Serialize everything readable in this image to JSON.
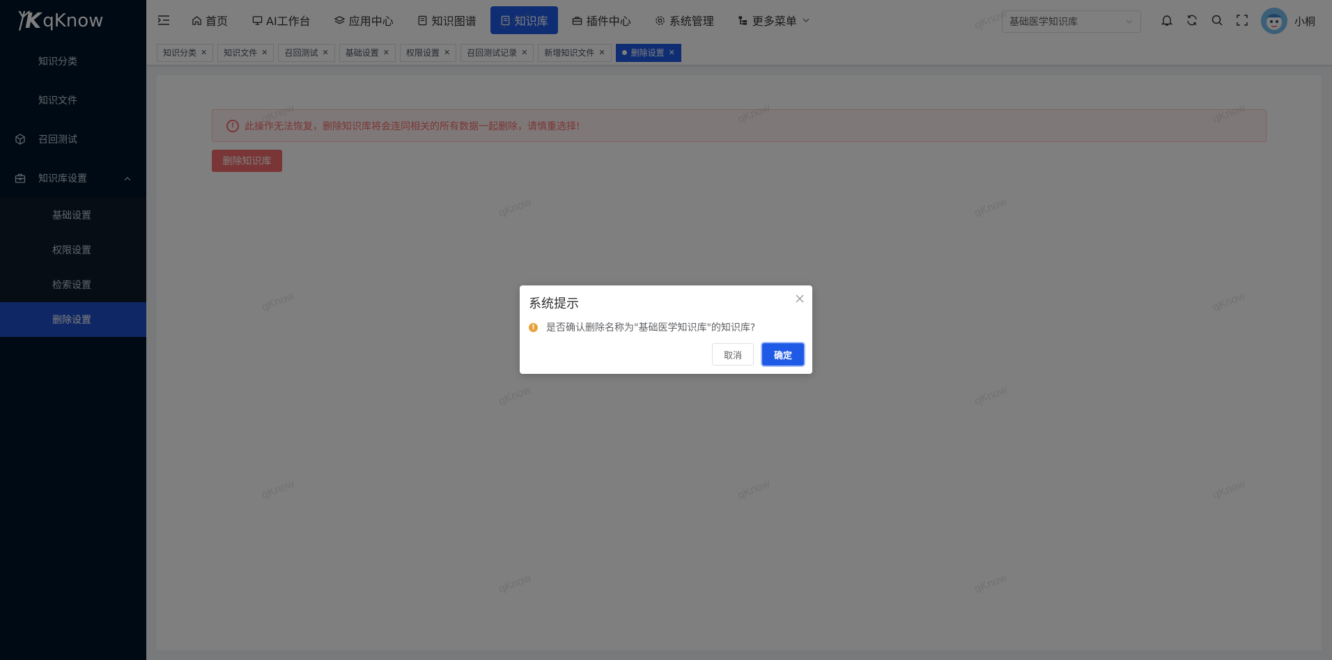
{
  "brand": {
    "logo_text": "qKnow"
  },
  "sidebar": {
    "items": [
      {
        "label": "知识分类"
      },
      {
        "label": "知识文件"
      },
      {
        "label": "召回测试"
      },
      {
        "label": "知识库设置"
      }
    ],
    "sub_items": [
      {
        "label": "基础设置"
      },
      {
        "label": "权限设置"
      },
      {
        "label": "检索设置"
      },
      {
        "label": "删除设置"
      }
    ]
  },
  "navbar": {
    "items": [
      {
        "label": "首页"
      },
      {
        "label": "AI工作台"
      },
      {
        "label": "应用中心"
      },
      {
        "label": "知识图谱"
      },
      {
        "label": "知识库"
      },
      {
        "label": "插件中心"
      },
      {
        "label": "系统管理"
      },
      {
        "label": "更多菜单"
      }
    ],
    "kb_selected": "基础医学知识库",
    "user_name": "小桐"
  },
  "tags": [
    {
      "label": "知识分类"
    },
    {
      "label": "知识文件"
    },
    {
      "label": "召回测试"
    },
    {
      "label": "基础设置"
    },
    {
      "label": "权限设置"
    },
    {
      "label": "召回测试记录"
    },
    {
      "label": "新增知识文件"
    },
    {
      "label": "删除设置"
    }
  ],
  "main": {
    "alert_text": "此操作无法恢复，删除知识库将会连同相关的所有数据一起删除，请慎重选择!",
    "delete_button": "删除知识库"
  },
  "dialog": {
    "title": "系统提示",
    "message": "是否确认删除名称为\"基础医学知识库\"的知识库?",
    "cancel": "取消",
    "confirm": "确定"
  },
  "watermark": "qKnow",
  "colors": {
    "primary": "#1f5ae6",
    "danger": "#f56c6c",
    "warning": "#e6a23c",
    "sidebar": "#001529"
  }
}
